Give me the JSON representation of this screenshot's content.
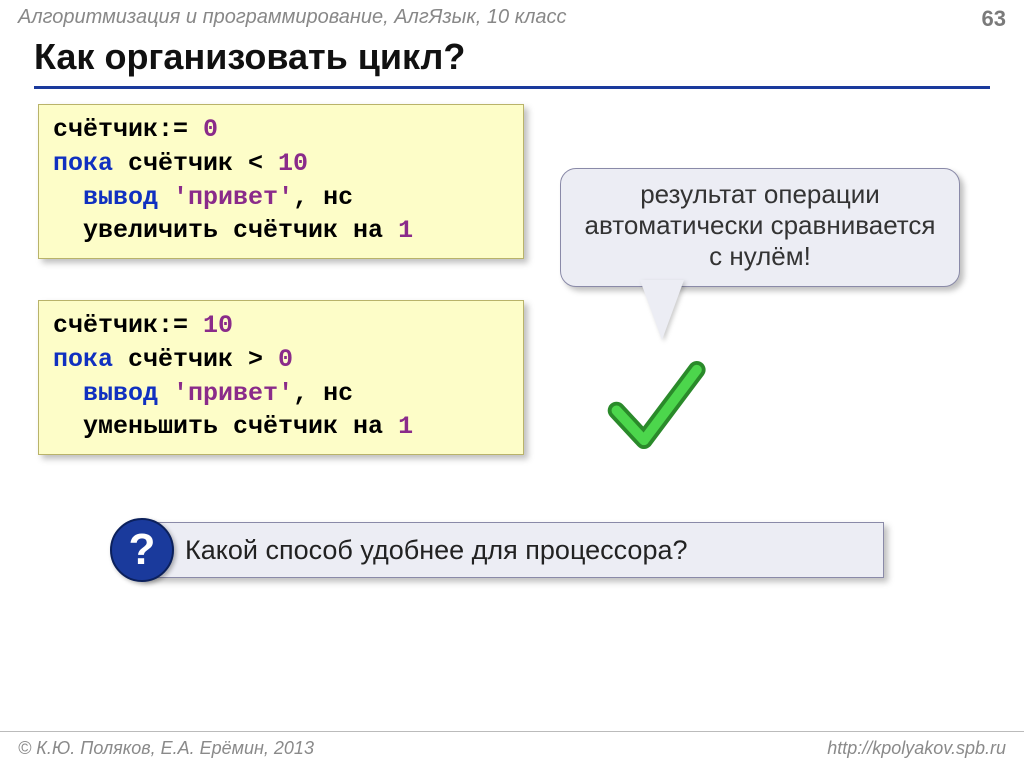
{
  "header": {
    "course": "Алгоритмизация и программирование, АлгЯзык, 10 класс",
    "page": "63"
  },
  "title": "Как организовать цикл?",
  "code1": {
    "l1a": "счётчик",
    "l1b": ":= ",
    "l1c": "0",
    "l2a": "пока",
    "l2b": " счётчик < ",
    "l2c": "10",
    "l3a": "  ",
    "l3b": "вывод",
    "l3c": " ",
    "l3d": "'привет'",
    "l3e": ", нс",
    "l4a": "  увеличить счётчик на ",
    "l4b": "1"
  },
  "code2": {
    "l1a": "счётчик",
    "l1b": ":= ",
    "l1c": "10",
    "l2a": "пока",
    "l2b": " счётчик > ",
    "l2c": "0",
    "l3a": "  ",
    "l3b": "вывод",
    "l3c": " ",
    "l3d": "'привет'",
    "l3e": ", нс",
    "l4a": "  уменьшить счётчик на ",
    "l4b": "1"
  },
  "callout_text": "результат операции автоматически сравнивается с нулём!",
  "question": {
    "mark": "?",
    "text": "Какой способ удобнее для процессора?"
  },
  "footer": {
    "left": "© К.Ю. Поляков, Е.А. Ерёмин, 2013",
    "right": "http://kpolyakov.spb.ru"
  }
}
